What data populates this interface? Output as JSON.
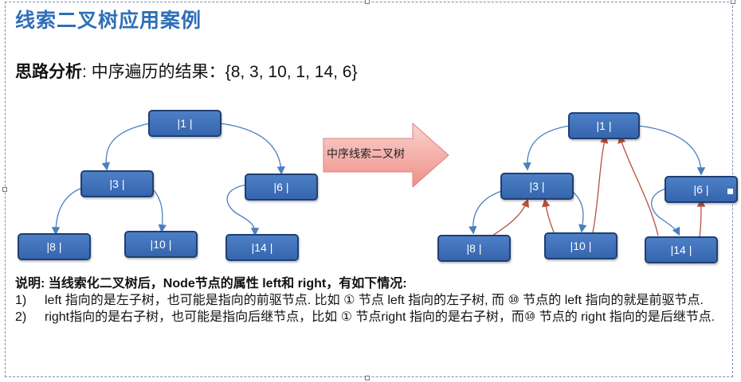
{
  "title": "线索二叉树应用案例",
  "analysis": {
    "label": "思路分析",
    "colon": ":",
    "text": " 中序遍历的结果：{8, 3, 10, 1, 14, 6}"
  },
  "arrow_label": "中序线索二叉树",
  "tree_left": {
    "nodes": [
      "|1 |",
      "|3 |",
      "|6 |",
      "|8 |",
      "|10 |",
      "|14 |"
    ]
  },
  "tree_right": {
    "nodes": [
      "|1 |",
      "|3 |",
      "|6 |",
      "|8 |",
      "|10 |",
      "|14 |"
    ]
  },
  "colors": {
    "title": "#2e6fb7",
    "node_fill": "#3f72bb",
    "child_link": "#4a7fc0",
    "thread_link": "#b5513a",
    "arrow_fill": "#f4a6a0"
  },
  "notes": {
    "heading": "说明: 当线索化二叉树后，Node节点的属性 left和 right，有如下情况:",
    "items": [
      {
        "num": "1)",
        "text": "left 指向的是左子树，也可能是指向的前驱节点. 比如 ① 节点 left 指向的左子树, 而 ⑩ 节点的 left 指向的就是前驱节点."
      },
      {
        "num": "2)",
        "text": "right指向的是右子树，也可能是指向后继节点，比如 ① 节点right 指向的是右子树，而⑩ 节点的 right 指向的是后继节点."
      }
    ]
  }
}
